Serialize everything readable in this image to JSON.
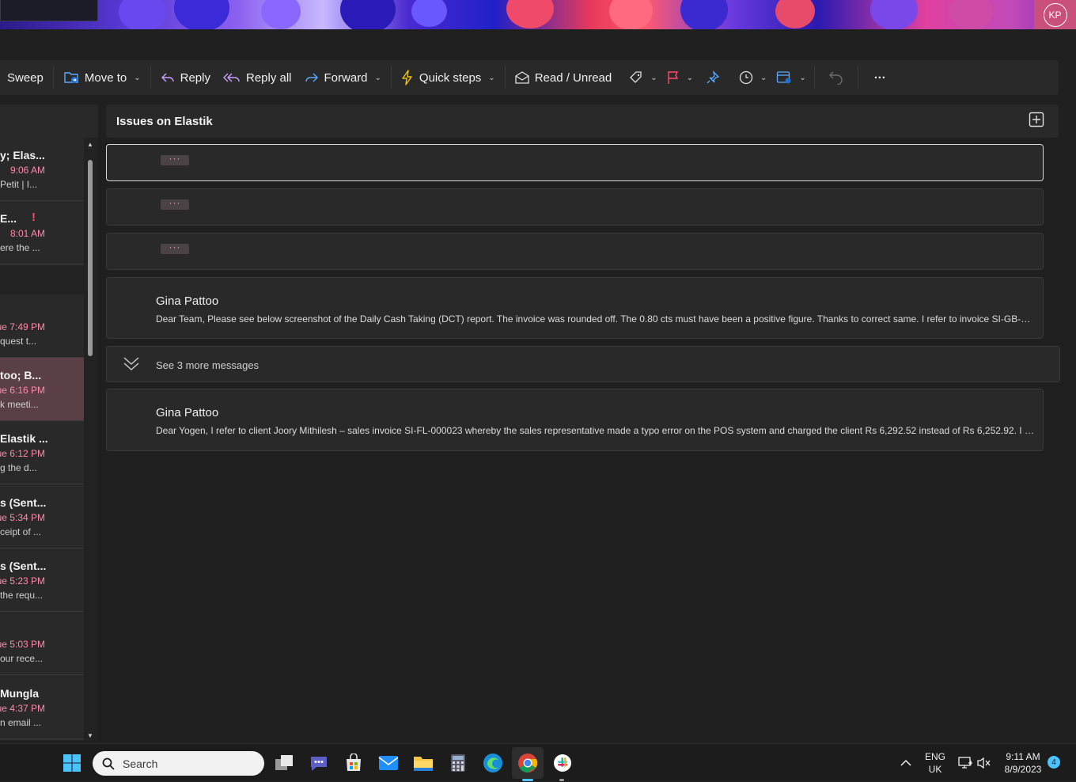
{
  "banner": {
    "avatar_initials": "KP"
  },
  "toolbar": {
    "sweep": "Sweep",
    "move_to": "Move to",
    "reply": "Reply",
    "reply_all": "Reply all",
    "forward": "Forward",
    "quick_steps": "Quick steps",
    "read_unread": "Read / Unread",
    "more": "···"
  },
  "mail_list": [
    {
      "from": "y; Elas...",
      "time": "9:06 AM",
      "preview": "Petit | I..."
    },
    {
      "from": "E...",
      "time": "8:01 AM",
      "preview": "ere the ..."
    },
    {
      "from": "",
      "time": "ue 7:49 PM",
      "preview": "quest t..."
    },
    {
      "from": "too; B...",
      "time": "ue 6:16 PM",
      "preview": "k meeti..."
    },
    {
      "from": "Elastik ...",
      "time": "ue 6:12 PM",
      "preview": "g the d..."
    },
    {
      "from": "s (Sent...",
      "time": "ue 5:34 PM",
      "preview": "ceipt of ..."
    },
    {
      "from": "s (Sent...",
      "time": "ue 5:23 PM",
      "preview": "the requ..."
    },
    {
      "from": "",
      "time": "ue 5:03 PM",
      "preview": "our rece..."
    },
    {
      "from": "Mungla",
      "time": "ue 4:37 PM",
      "preview": "n email ..."
    }
  ],
  "reading": {
    "subject": "Issues on Elastik",
    "collapsed_placeholder": "···",
    "messages": [
      {
        "sender": "Gina Pattoo",
        "body": "Dear Team, Please see below screenshot of the Daily Cash Taking (DCT) report. The invoice was rounded off. The 0.80 cts must have been a positive figure. Thanks to correct same. I refer to invoice SI-GB-23..."
      },
      {
        "sender": "Gina Pattoo",
        "body": "Dear Yogen, I refer to client Joory Mithilesh – sales invoice SI-FL-000023 whereby the sales representative made a typo error on the POS system and charged the client Rs 6,292.52 instead of Rs 6,252.92. I n..."
      }
    ],
    "see_more": "See 3 more messages"
  },
  "taskbar": {
    "search_placeholder": "Search",
    "lang_top": "ENG",
    "lang_bottom": "UK",
    "time": "9:11 AM",
    "date": "8/9/2023",
    "notification_count": "4"
  },
  "colors": {
    "accent": "#4cc2ff",
    "flag": "#ff4a6a",
    "time": "#ff8aa8",
    "selected": "#5a4046"
  }
}
